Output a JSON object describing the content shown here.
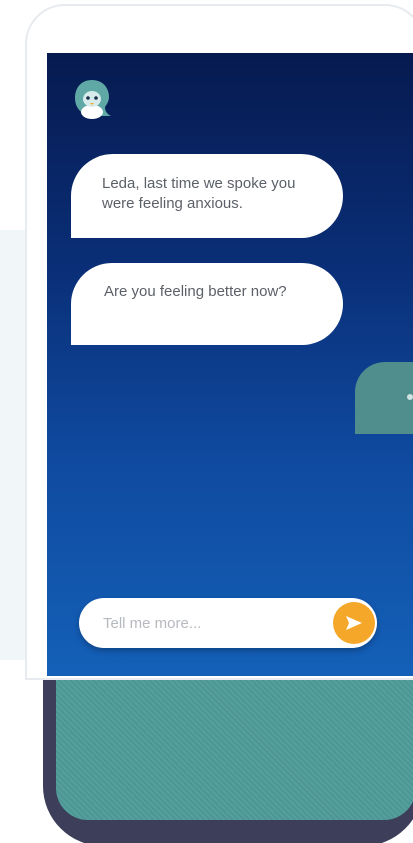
{
  "chat": {
    "avatar_icon": "mascot-avatar-icon",
    "messages": [
      {
        "sender": "bot",
        "text": "Leda,  last time we spoke you were feeling anxious."
      },
      {
        "sender": "bot",
        "text": "Are you feeling better now?"
      }
    ],
    "input": {
      "placeholder": "Tell me more...",
      "value": ""
    },
    "send_icon": "send-arrow-icon"
  },
  "colors": {
    "screen_top": "#061a4f",
    "screen_bottom": "#1460b8",
    "bubble": "#ffffff",
    "send_button": "#f5a72a",
    "accent_teal": "#4f8e8c",
    "device_frame": "#3c3e5a"
  }
}
